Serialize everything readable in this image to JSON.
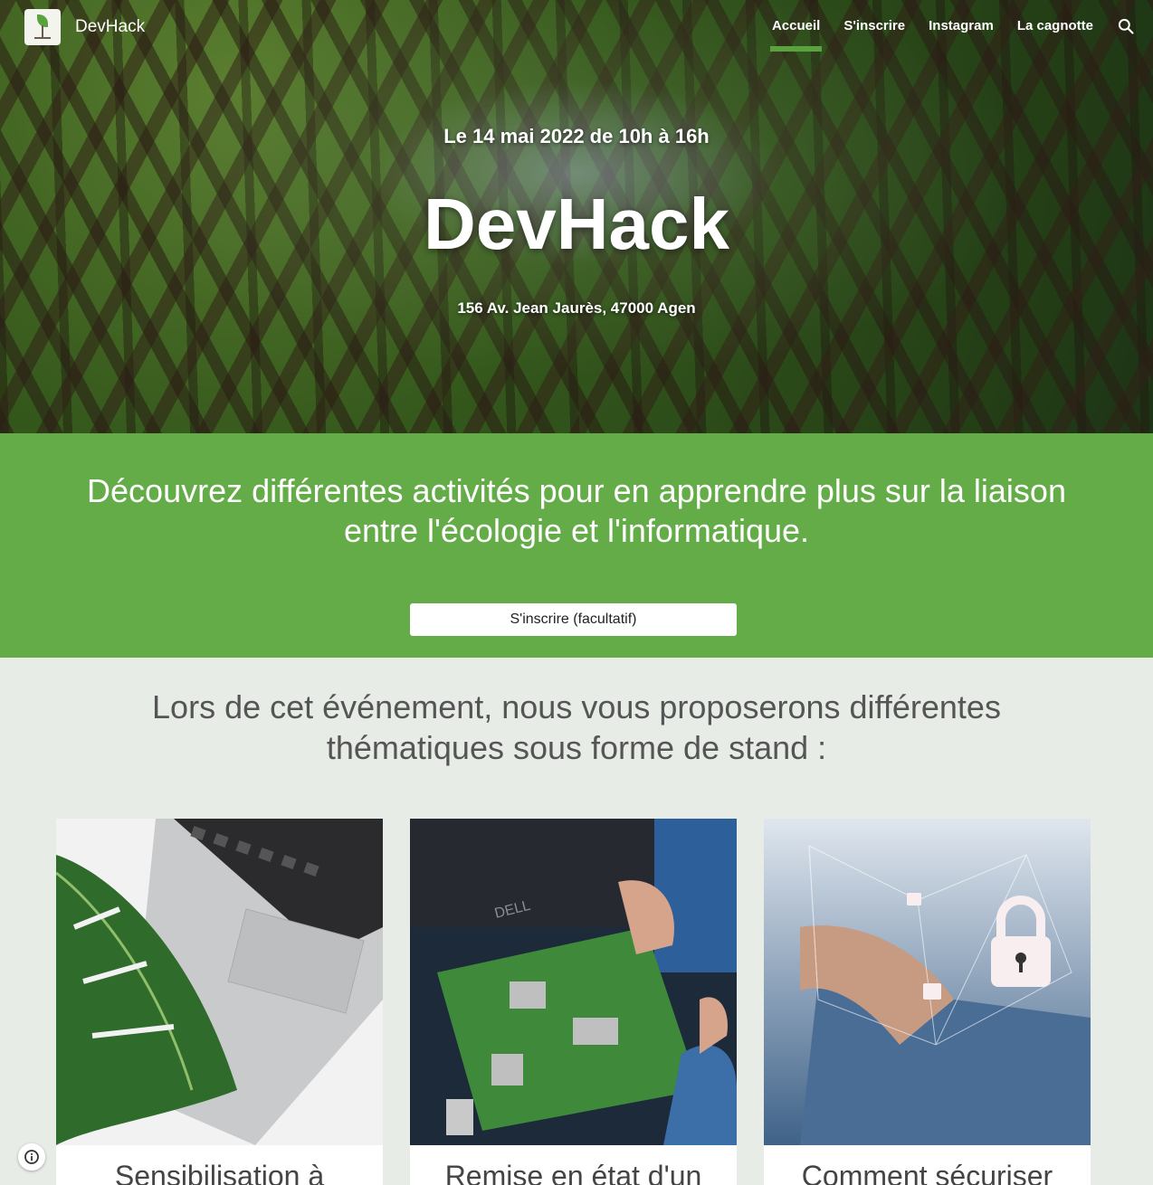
{
  "header": {
    "site_title": "DevHack",
    "logo_icon": "devhack-logo-icon",
    "nav": [
      {
        "label": "Accueil",
        "active": true
      },
      {
        "label": "S'inscrire",
        "active": false
      },
      {
        "label": "Instagram",
        "active": false
      },
      {
        "label": "La cagnotte",
        "active": false
      }
    ],
    "search_icon": "search-icon"
  },
  "hero": {
    "date": "Le 14 mai 2022 de 10h à 16h",
    "title": "DevHack",
    "address": "156 Av. Jean Jaurès, 47000 Agen"
  },
  "band": {
    "text": "Découvrez différentes activités pour en apprendre plus sur la liaison entre l'écologie et l'informatique.",
    "button_label": "S'inscrire (facultatif)"
  },
  "section": {
    "title": "Lors de cet événement, nous vous proposerons différentes thématiques sous forme de stand :"
  },
  "cards": [
    {
      "caption": "Sensibilisation à"
    },
    {
      "caption": "Remise en état d'un"
    },
    {
      "caption": "Comment sécuriser"
    }
  ],
  "colors": {
    "accent_green": "#64ac48",
    "nav_underline": "#58a33e",
    "page_background": "#e8ece7"
  }
}
